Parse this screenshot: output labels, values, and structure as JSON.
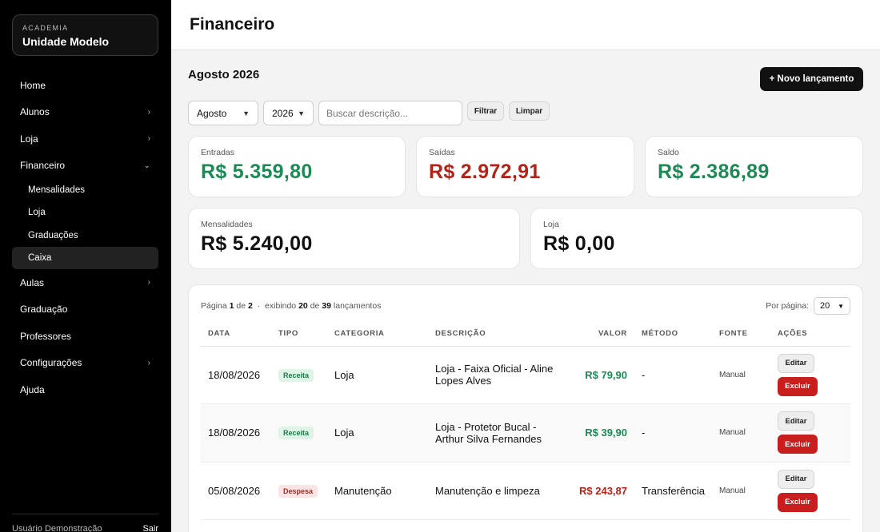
{
  "brand": {
    "small": "ACADEMIA",
    "name": "Unidade Modelo"
  },
  "nav": {
    "items": [
      {
        "label": "Home",
        "chevron": ""
      },
      {
        "label": "Alunos",
        "chevron": "›"
      },
      {
        "label": "Loja",
        "chevron": "›"
      },
      {
        "label": "Financeiro",
        "chevron": "⌄"
      }
    ],
    "sub": [
      "Mensalidades",
      "Loja",
      "Graduações",
      "Caixa"
    ],
    "items2": [
      {
        "label": "Aulas",
        "chevron": "›"
      },
      {
        "label": "Graduação",
        "chevron": ""
      },
      {
        "label": "Professores",
        "chevron": ""
      },
      {
        "label": "Configurações",
        "chevron": "›"
      },
      {
        "label": "Ajuda",
        "chevron": ""
      }
    ]
  },
  "footer": {
    "user": "Usuário Demonstração",
    "logout": "Sair"
  },
  "header": {
    "title": "Financeiro"
  },
  "main": {
    "month_title": "Agosto 2026",
    "new_button": "+ Novo lançamento",
    "filters": {
      "month": "Agosto",
      "year": "2026",
      "search_placeholder": "Buscar descrição...",
      "filter_button": "Filtrar",
      "clear_button": "Limpar"
    },
    "cards": {
      "entradas": {
        "label": "Entradas",
        "value": "R$ 5.359,80"
      },
      "saidas": {
        "label": "Saídas",
        "value": "R$ 2.972,91"
      },
      "saldo": {
        "label": "Saldo",
        "value": "R$ 2.386,89"
      },
      "mensalidades": {
        "label": "Mensalidades",
        "value": "R$ 5.240,00"
      },
      "loja": {
        "label": "Loja",
        "value": "R$ 0,00"
      }
    },
    "pager": {
      "page_word": "Página",
      "page": "1",
      "of_word": "de",
      "pages": "2",
      "sep": "·",
      "showing_word": "exibindo",
      "shown": "20",
      "total": "39",
      "items_word": "lançamentos"
    },
    "per_page": {
      "label": "Por página:",
      "value": "20"
    },
    "table": {
      "headers": [
        "DATA",
        "TIPO",
        "CATEGORIA",
        "DESCRIÇÃO",
        "VALOR",
        "MÉTODO",
        "FONTE",
        "AÇÕES"
      ],
      "rows": [
        {
          "date": "18/08/2026",
          "type": "Receita",
          "category": "Loja",
          "description": "Loja - Faixa Oficial - Aline Lopes Alves",
          "value": "R$ 79,90",
          "method": "-",
          "source": "Manual"
        },
        {
          "date": "18/08/2026",
          "type": "Receita",
          "category": "Loja",
          "description": "Loja - Protetor Bucal - Arthur Silva Fernandes",
          "value": "R$ 39,90",
          "method": "-",
          "source": "Manual"
        },
        {
          "date": "05/08/2026",
          "type": "Despesa",
          "category": "Manutenção",
          "description": "Manutenção e limpeza",
          "value": "R$ 243,87",
          "method": "Transferência",
          "source": "Manual"
        }
      ],
      "edit_label": "Editar",
      "delete_label": "Excluir"
    }
  },
  "colors": {
    "green": "#1d8a55",
    "red": "#b42318",
    "sidebar": "#000000",
    "delete": "#c81e1e"
  }
}
